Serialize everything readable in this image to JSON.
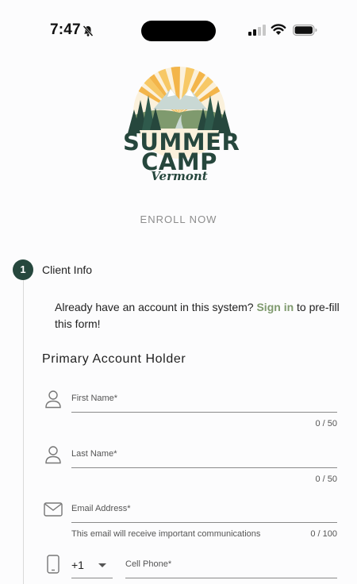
{
  "status_bar": {
    "time": "7:47",
    "icons": [
      "bell-slash-icon",
      "signal-icon",
      "wifi-icon",
      "battery-icon"
    ]
  },
  "logo": {
    "line1": "SUMMER",
    "line2": "CAMP",
    "line3": "Vermont"
  },
  "header": {
    "enroll_label": "ENROLL NOW"
  },
  "step": {
    "number": "1",
    "title": "Client Info"
  },
  "signin": {
    "text_before": "Already have an account in this system?",
    "link_label": "Sign in",
    "text_after": "to pre-fill this form!"
  },
  "section": {
    "title": "Primary Account Holder"
  },
  "fields": {
    "first_name": {
      "label": "First Name*",
      "icon": "person-icon",
      "counter": "0 / 50",
      "value": ""
    },
    "last_name": {
      "label": "Last Name*",
      "icon": "person-icon",
      "counter": "0 / 50",
      "value": ""
    },
    "email": {
      "label": "Email Address*",
      "icon": "envelope-icon",
      "hint": "This email will receive important communications",
      "counter": "0 / 100",
      "value": ""
    },
    "cell_phone": {
      "label": "Cell Phone*",
      "icon": "mobile-phone-icon",
      "country_code": "+1",
      "value": ""
    }
  },
  "colors": {
    "brand_dark_green": "#26473d",
    "link_green": "#7f9a6e",
    "sun_orange": "#f3b54a"
  }
}
